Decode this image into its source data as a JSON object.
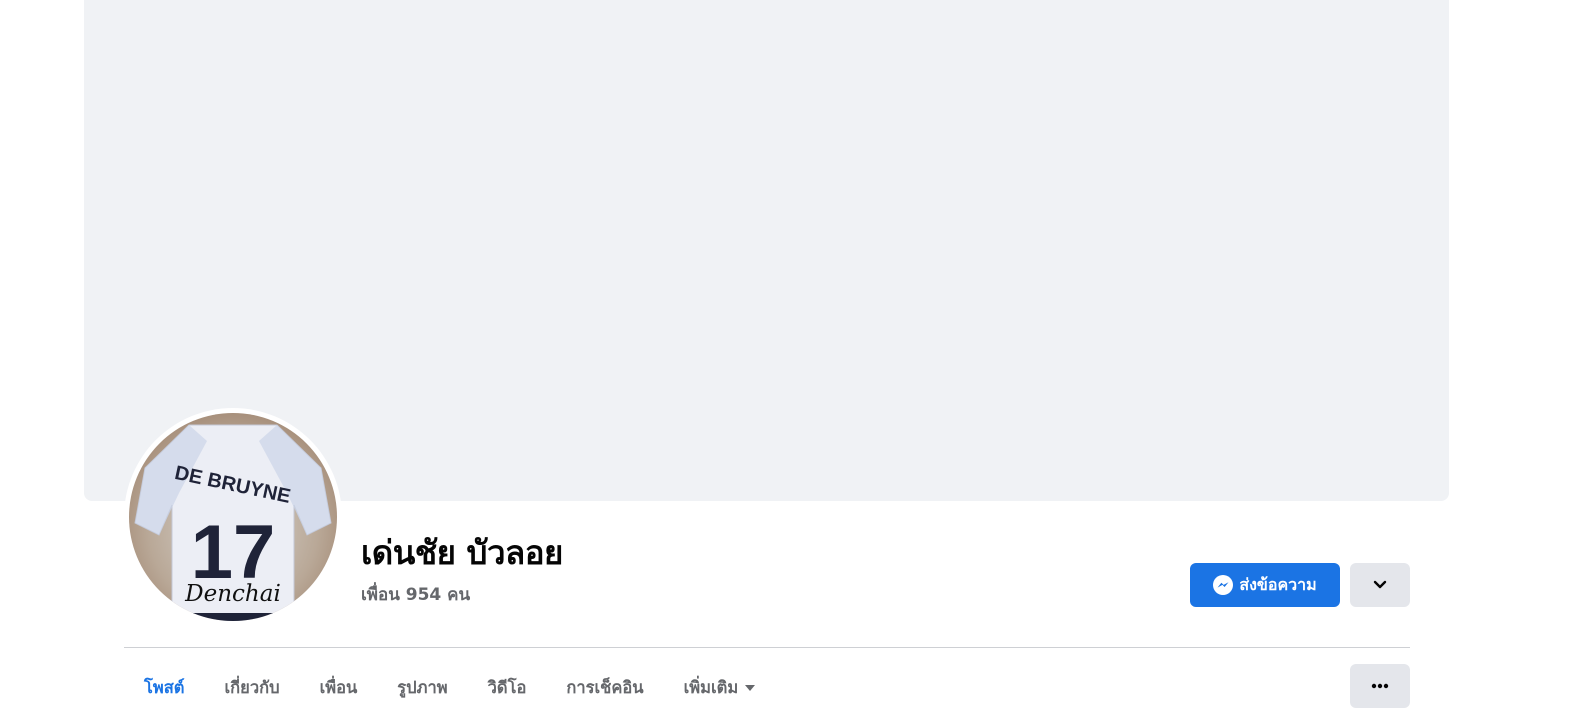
{
  "profile": {
    "name": "เด่นชัย บัวลอย",
    "friends_text": "เพื่อน 954 คน",
    "avatar": {
      "jersey_name": "DE BRUYNE",
      "jersey_number": "17",
      "signature": "Denchai"
    }
  },
  "actions": {
    "message_label": "ส่งข้อความ",
    "message_icon": "messenger-icon",
    "dropdown_icon": "chevron-down-icon",
    "more_icon": "more-horizontal-icon"
  },
  "tabs": [
    {
      "label": "โพสต์",
      "active": true
    },
    {
      "label": "เกี่ยวกับ",
      "active": false
    },
    {
      "label": "เพื่อน",
      "active": false
    },
    {
      "label": "รูปภาพ",
      "active": false
    },
    {
      "label": "วิดีโอ",
      "active": false
    },
    {
      "label": "การเช็คอิน",
      "active": false
    },
    {
      "label": "เพิ่มเติม",
      "active": false
    }
  ],
  "colors": {
    "accent": "#1b74e4",
    "cover_background": "#f0f2f5",
    "secondary_button": "#e4e6eb",
    "secondary_text": "#65676b"
  }
}
